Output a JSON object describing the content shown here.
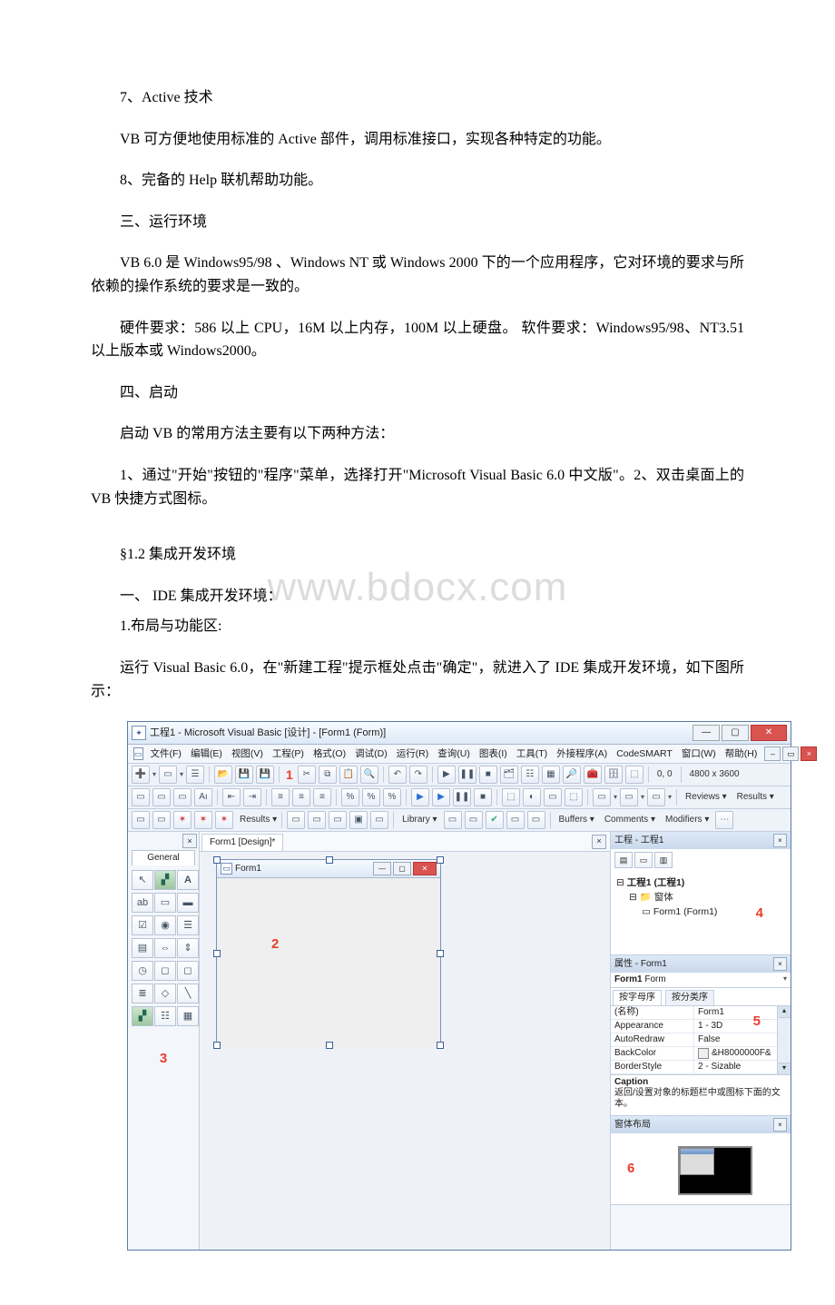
{
  "watermark": "www.bdocx.com",
  "paragraphs": {
    "p1": "7、Active 技术",
    "p2": "VB 可方便地使用标准的 Active 部件，调用标准接口，实现各种特定的功能。",
    "p3": "8、完备的 Help 联机帮助功能。",
    "p4": "三、运行环境",
    "p5": "VB 6.0 是 Windows95/98 、Windows NT 或 Windows 2000 下的一个应用程序，它对环境的要求与所依赖的操作系统的要求是一致的。",
    "p6": "硬件要求：586 以上 CPU，16M 以上内存，100M 以上硬盘。 软件要求：Windows95/98、NT3.51 以上版本或 Windows2000。",
    "p7": "四、启动",
    "p8": "启动 VB 的常用方法主要有以下两种方法：",
    "p9": "1、通过\"开始\"按钮的\"程序\"菜单，选择打开\"Microsoft Visual Basic 6.0 中文版\"。2、双击桌面上的 VB 快捷方式图标。",
    "p10": "§1.2 集成开发环境",
    "p11": "一、 IDE 集成开发环境：",
    "p12": "1.布局与功能区:",
    "p13": "运行 Visual Basic 6.0，在\"新建工程\"提示框处点击\"确定\"，就进入了 IDE 集成开发环境，如下图所示："
  },
  "ide": {
    "title": "工程1 - Microsoft Visual Basic [设计] - [Form1 (Form)]",
    "menus": [
      "文件(F)",
      "编辑(E)",
      "视图(V)",
      "工程(P)",
      "格式(O)",
      "调试(D)",
      "运行(R)",
      "查询(U)",
      "图表(I)",
      "工具(T)",
      "外接程序(A)",
      "CodeSMART",
      "窗口(W)",
      "帮助(H)"
    ],
    "toolbar1": {
      "coords": "0, 0",
      "size": "4800 x 3600",
      "red": "1"
    },
    "toolbar2": {
      "reviews": "Reviews ▾",
      "results": "Results ▾"
    },
    "toolbar3": {
      "library": "Library ▾",
      "buffers": "Buffers ▾",
      "comments": "Comments ▾",
      "modifiers": "Modifiers ▾"
    },
    "toolbox": {
      "tab": "General",
      "red": "3"
    },
    "doc_tab": "Form1 [Design]*",
    "form": {
      "title": "Form1",
      "red": "2"
    },
    "project": {
      "title": "工程 - 工程1",
      "root": "工程1 (工程1)",
      "folder": "窗体",
      "item": "Form1 (Form1)",
      "red": "4"
    },
    "properties": {
      "title": "属性 - Form1",
      "object_name": "Form1",
      "object_type": "Form",
      "tab_alpha": "按字母序",
      "tab_cat": "按分类序",
      "rows": [
        {
          "name": "(名称)",
          "value": "Form1"
        },
        {
          "name": "Appearance",
          "value": "1 - 3D"
        },
        {
          "name": "AutoRedraw",
          "value": "False"
        },
        {
          "name": "BackColor",
          "value": "&H8000000F&"
        },
        {
          "name": "BorderStyle",
          "value": "2 - Sizable"
        }
      ],
      "red": "5",
      "desc_title": "Caption",
      "desc_body": "返回/设置对象的标题栏中或图标下面的文本。"
    },
    "layout": {
      "title": "窗体布局",
      "red": "6"
    }
  }
}
